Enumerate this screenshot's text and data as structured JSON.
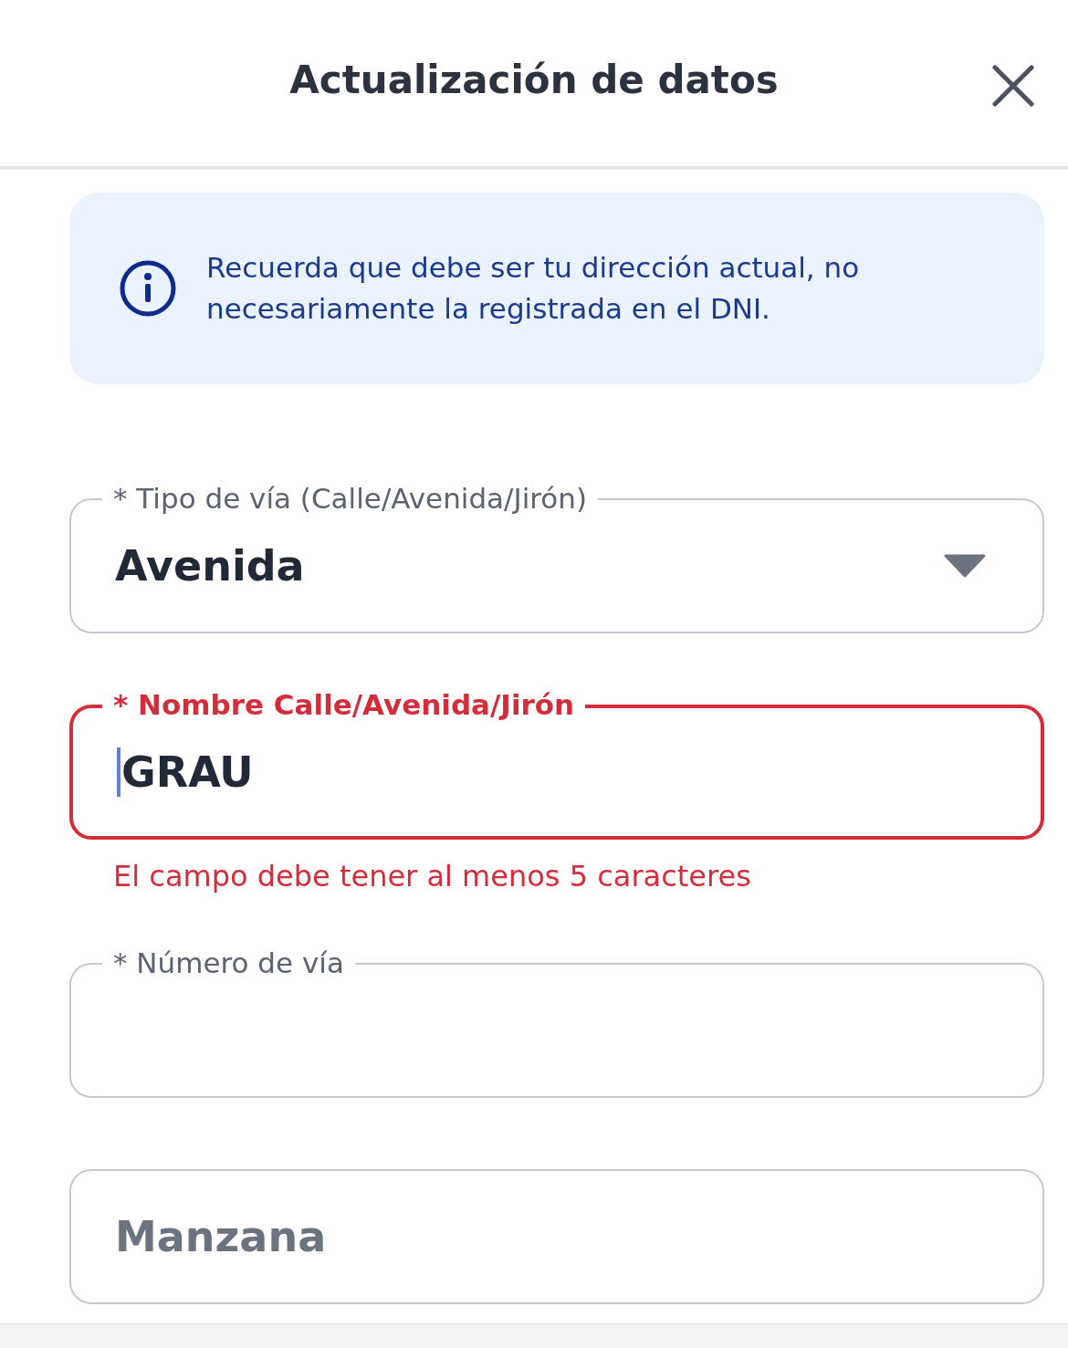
{
  "header": {
    "title": "Actualización de datos"
  },
  "info": {
    "text": "Recuerda que debe ser tu dirección actual, no necesariamente la registrada en el DNI."
  },
  "fields": [
    {
      "kind": "select",
      "label": "* Tipo de vía (Calle/Avenida/Jirón)",
      "value": "Avenida",
      "error": false,
      "focused": false
    },
    {
      "kind": "text",
      "label": "* Nombre Calle/Avenida/Jirón",
      "value": "GRAU",
      "error": true,
      "focused": true,
      "error_text": "El campo debe tener al menos 5 caracteres"
    },
    {
      "kind": "text",
      "label": "* Número de vía",
      "error": false,
      "focused": false
    },
    {
      "kind": "text",
      "placeholder": "Manzana",
      "error": false,
      "focused": false
    }
  ]
}
